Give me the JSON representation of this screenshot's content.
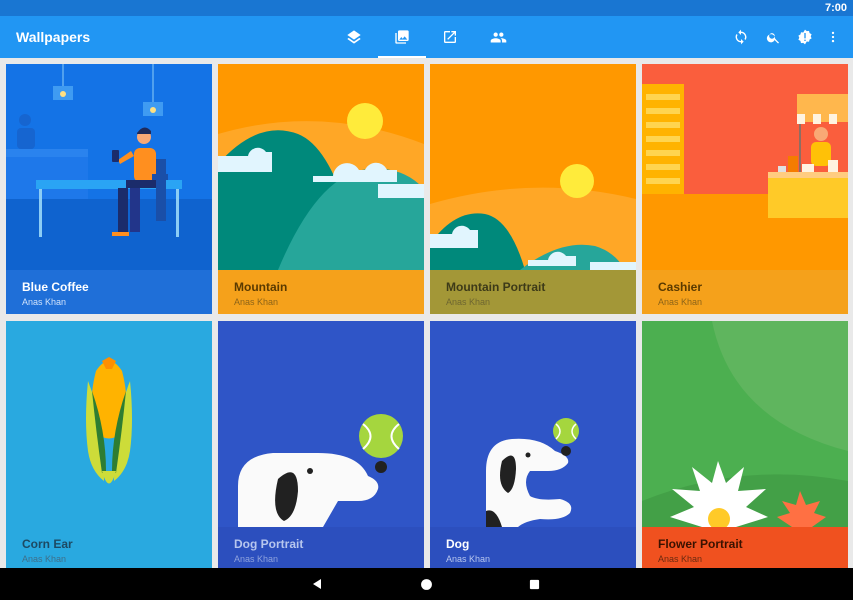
{
  "status_bar": {
    "time": "7:00"
  },
  "app_bar": {
    "title": "Wallpapers",
    "tabs": [
      {
        "icon": "layers-icon",
        "active": false
      },
      {
        "icon": "photo-library-icon",
        "active": true
      },
      {
        "icon": "open-in-new-icon",
        "active": false
      },
      {
        "icon": "people-icon",
        "active": false
      }
    ],
    "actions": [
      "sync-icon",
      "search-icon",
      "settings-badge-icon",
      "more-vert-icon"
    ]
  },
  "wallpapers": [
    {
      "name": "Blue Coffee",
      "author": "Anas Khan",
      "bg": "#1473e6",
      "caption_bg": "#1f6fd8"
    },
    {
      "name": "Mountain",
      "author": "Anas Khan",
      "bg": "#ff9800",
      "caption_bg": "#f5a11b"
    },
    {
      "name": "Mountain Portrait",
      "author": "Anas Khan",
      "bg": "#ff9800",
      "caption_bg": "#a39737"
    },
    {
      "name": "Cashier",
      "author": "Anas Khan",
      "bg": "#fa5e3d",
      "caption_bg": "#f5a11b"
    },
    {
      "name": "Corn Ear",
      "author": "Anas Khan",
      "bg": "#29a9e0",
      "caption_bg": "#29a9e0"
    },
    {
      "name": "Dog Portrait",
      "author": "Anas Khan",
      "bg": "#2f55c7",
      "caption_bg": "#2c4fbe"
    },
    {
      "name": "Dog",
      "author": "Anas Khan",
      "bg": "#2f55c7",
      "caption_bg": "#2c4fbe"
    },
    {
      "name": "Flower Portrait",
      "author": "Anas Khan",
      "bg": "#5fb55e",
      "caption_bg": "#f0511f"
    }
  ],
  "nav_bar": {
    "buttons": [
      "back-icon",
      "home-icon",
      "recents-icon"
    ]
  }
}
